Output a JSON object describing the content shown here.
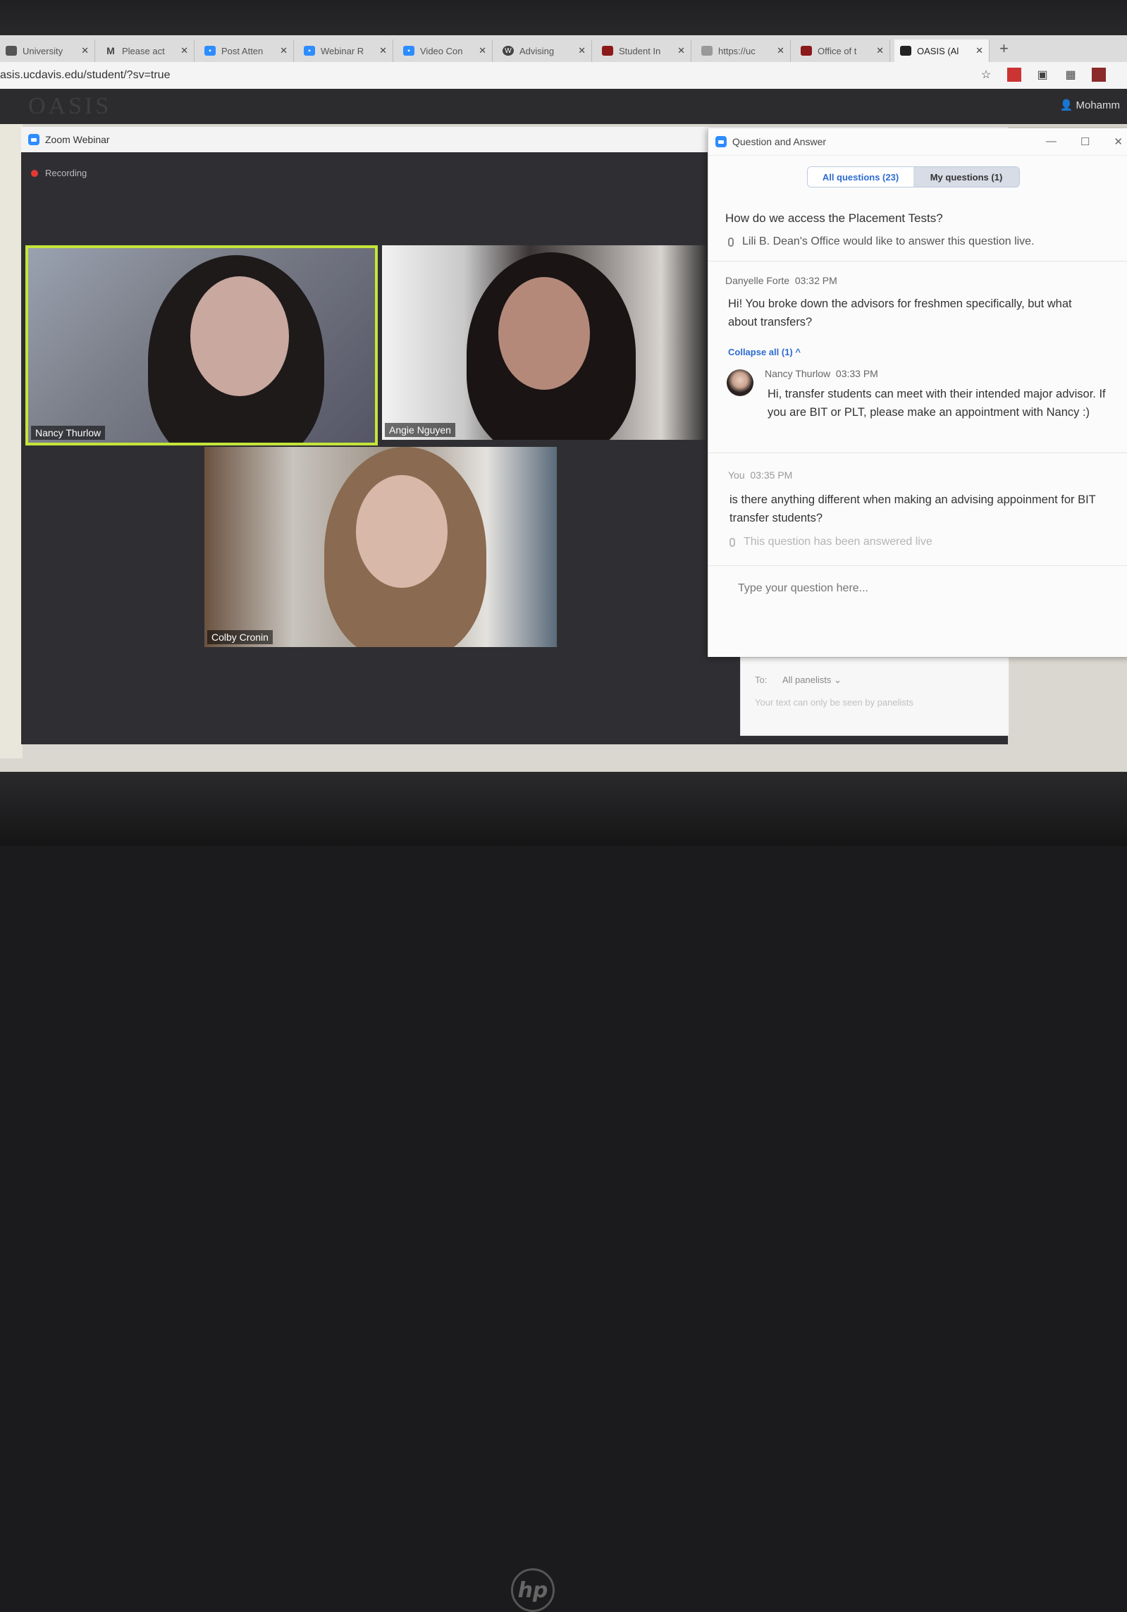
{
  "browser": {
    "tabs": [
      {
        "label": "University",
        "icon": "university-icon",
        "color": "#555555"
      },
      {
        "label": "Please act",
        "icon": "gmail-icon",
        "color": "#555555"
      },
      {
        "label": "Post Atten",
        "icon": "zoom-icon",
        "color": "#2d8cff"
      },
      {
        "label": "Webinar R",
        "icon": "zoom-icon",
        "color": "#2d8cff"
      },
      {
        "label": "Video Con",
        "icon": "zoom-icon",
        "color": "#2d8cff"
      },
      {
        "label": "Advising",
        "icon": "wordpress-icon",
        "color": "#444444"
      },
      {
        "label": "Student In",
        "icon": "graduation-cap-icon",
        "color": "#8b1a1a"
      },
      {
        "label": "https://uc",
        "icon": "document-icon",
        "color": "#777777"
      },
      {
        "label": "Office of t",
        "icon": "graduation-cap-icon",
        "color": "#8b1a1a"
      },
      {
        "label": "OASIS (Al",
        "icon": "oasis-icon",
        "color": "#222222"
      }
    ],
    "url": "asis.ucdavis.edu/student/?sv=true"
  },
  "oasis": {
    "logo": "OASIS",
    "user": "Mohamm"
  },
  "zoom": {
    "title": "Zoom Webinar",
    "recording_label": "Recording",
    "participants": [
      {
        "name": "Nancy Thurlow"
      },
      {
        "name": "Angie Nguyen"
      },
      {
        "name": "Colby Cronin"
      }
    ]
  },
  "qa": {
    "title": "Question and Answer",
    "tab_all": "All questions (23)",
    "tab_mine": "My questions (1)",
    "q1": {
      "text": "How do we access the Placement Tests?",
      "answer_note": "Lili B. Dean's Office would like to answer this question live."
    },
    "q2": {
      "author": "Danyelle Forte",
      "time": "03:32 PM",
      "text": "Hi! You broke down the advisors for freshmen specifically, but what about transfers?",
      "collapse": "Collapse all (1) ^",
      "reply": {
        "author": "Nancy Thurlow",
        "time": "03:33 PM",
        "text": "Hi, transfer students can meet with their intended major advisor. If you are BIT or PLT, please make an appointment with Nancy :)"
      }
    },
    "q3": {
      "author": "You",
      "time": "03:35 PM",
      "text": "is there anything different when making an advising appoinment for BIT transfer students?",
      "status": "This question has been answered live"
    },
    "input_placeholder": "Type your question here..."
  },
  "chat": {
    "to_label": "To:",
    "to_value": "All panelists",
    "note": "Your text can only be seen by panelists"
  },
  "device": {
    "brand": "hp"
  }
}
